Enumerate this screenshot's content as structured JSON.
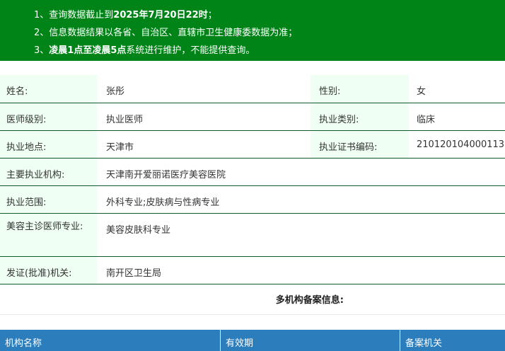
{
  "notice": {
    "line1_prefix": "1、查询数据截止到",
    "line1_bold": "2025年7月20日22时",
    "line1_suffix": "；",
    "line2": "2、信息数据结果以各省、自治区、直辖市卫生健康委数据为准；",
    "line3_prefix": "3、",
    "line3_bold": "凌晨1点至凌晨5点",
    "line3_suffix": "系统进行维护，不能提供查询。"
  },
  "info": {
    "name_label": "姓名:",
    "name_value": "张彤",
    "gender_label": "性别:",
    "gender_value": "女",
    "level_label": "医师级别:",
    "level_value": "执业医师",
    "category_label": "执业类别:",
    "category_value": "临床",
    "location_label": "执业地点:",
    "location_value": "天津市",
    "cert_label": "执业证书编码:",
    "cert_value": "210120104000113",
    "institution_label": "主要执业机构:",
    "institution_value": "天津南开爱丽诺医疗美容医院",
    "scope_label": "执业范围:",
    "scope_value": "外科专业;皮肤病与性病专业",
    "cosmetic_label": "美容主诊医师专业:",
    "cosmetic_value": "美容皮肤科专业",
    "issuer_label": "发证(批准)机关:",
    "issuer_value": "南开区卫生局"
  },
  "multi_title": "多机构备案信息:",
  "table": {
    "headers": [
      "机构名称",
      "有效期",
      "备案机关"
    ]
  }
}
